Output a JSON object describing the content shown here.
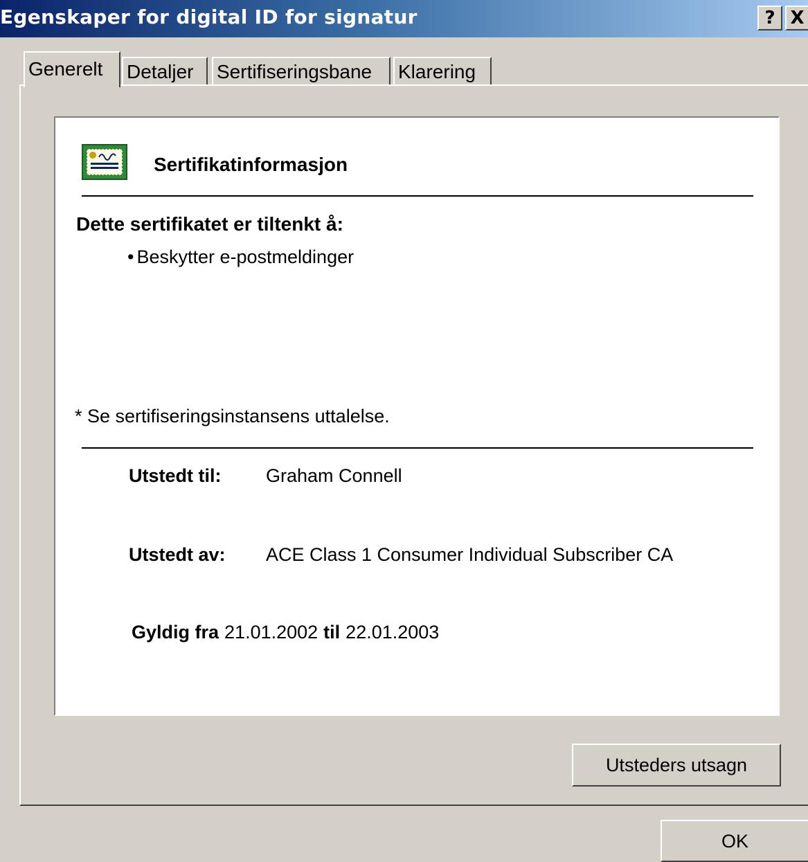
{
  "window": {
    "title": "Egenskaper for digital ID for signatur",
    "help_label": "?",
    "close_label": "X"
  },
  "tabs": [
    {
      "label": "Generelt",
      "active": true
    },
    {
      "label": "Detaljer",
      "active": false
    },
    {
      "label": "Sertifiseringsbane",
      "active": false
    },
    {
      "label": "Klarering",
      "active": false
    }
  ],
  "panel": {
    "icon": "certificate-icon",
    "title": "Sertifikatinformasjon",
    "intended_heading": "Dette sertifikatet er tiltenkt å:",
    "purposes": [
      "Beskytter e-postmeldinger"
    ],
    "note": "* Se sertifiseringsinstansens uttalelse.",
    "issued_to_label": "Utstedt til:",
    "issued_to_value": "Graham Connell",
    "issued_by_label": "Utstedt av:",
    "issued_by_value": "ACE Class 1 Consumer Individual Subscriber CA",
    "valid_from_label": "Gyldig fra",
    "valid_from_value": "21.01.2002",
    "valid_to_label": "til",
    "valid_to_value": "22.01.2003"
  },
  "buttons": {
    "issuer_statement": "Utsteders utsagn",
    "ok": "OK"
  }
}
